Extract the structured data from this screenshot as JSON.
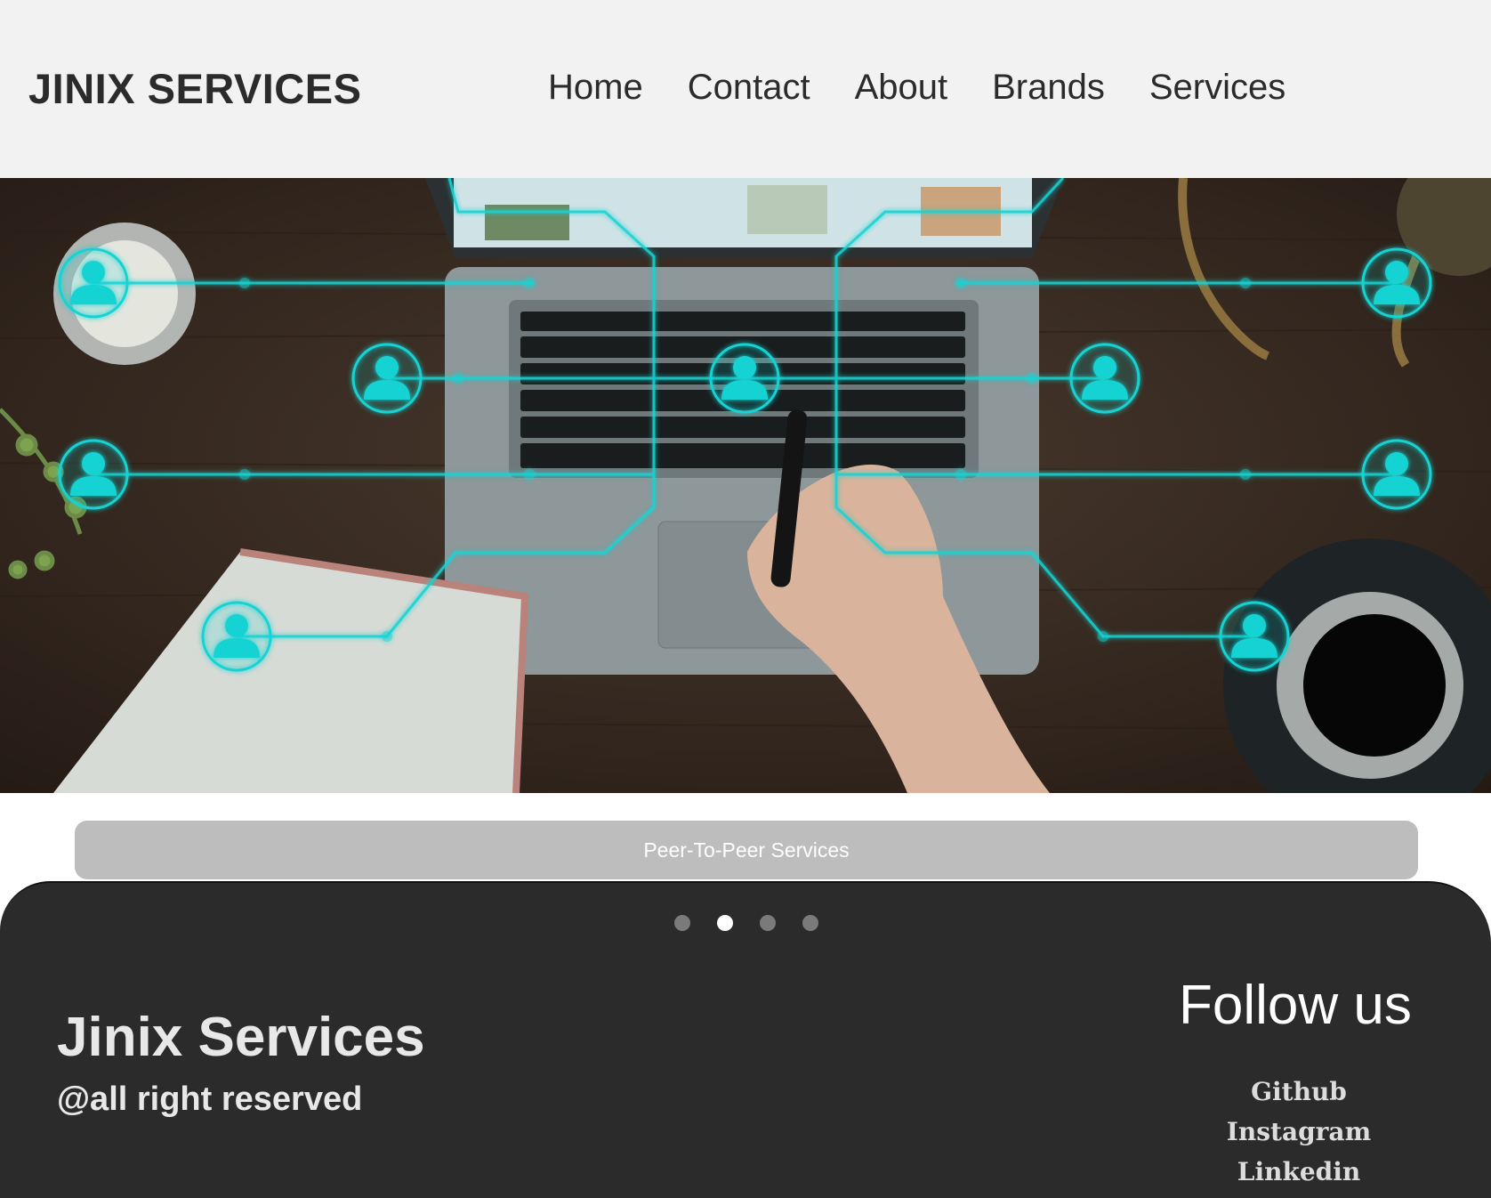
{
  "header": {
    "brand": "JINIX SERVICES",
    "nav": [
      "Home",
      "Contact",
      "About",
      "Brands",
      "Services"
    ]
  },
  "hero": {
    "image": "laptop-network-people-icons",
    "accent_color": "#19d3d3"
  },
  "carousel": {
    "caption": "Peer-To-Peer Services",
    "slide_count": 4,
    "active_index": 1
  },
  "footer": {
    "title": "Jinix Services",
    "subtitle": "@all right reserved",
    "follow_title": "Follow us",
    "links": [
      "Github",
      "Instagram",
      "Linkedin"
    ]
  }
}
